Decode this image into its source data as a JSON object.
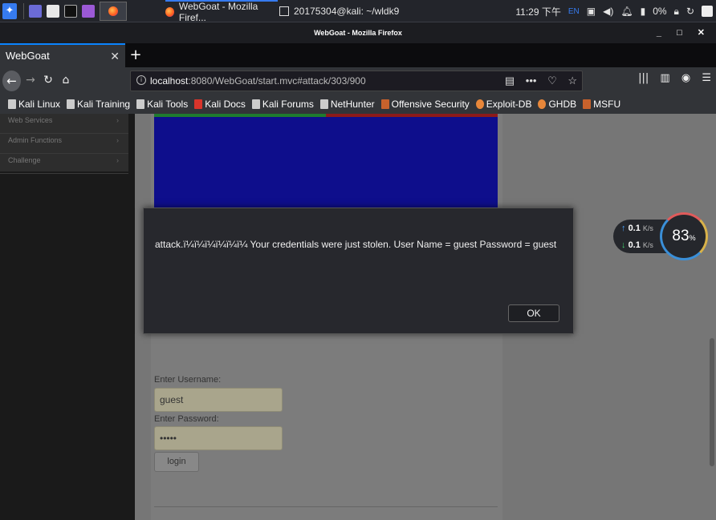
{
  "taskbar": {
    "tasks": [
      {
        "label": "WebGoat - Mozilla Firef..."
      },
      {
        "label": "20175304@kali: ~/wldk9"
      }
    ],
    "time": "11:29 下午",
    "lang": "EN",
    "battery": "0%"
  },
  "window": {
    "title": "WebGoat - Mozilla Firefox",
    "controls": "_ □ ✕"
  },
  "tab": {
    "label": "WebGoat",
    "close": "✕",
    "new": "+"
  },
  "nav": {
    "url_host": "localhost",
    "url_rest": ":8080/WebGoat/start.mvc#attack/303/900"
  },
  "bookmarks": [
    {
      "label": "Kali Linux",
      "color": "#cccccc"
    },
    {
      "label": "Kali Training",
      "color": "#cccccc"
    },
    {
      "label": "Kali Tools",
      "color": "#cccccc"
    },
    {
      "label": "Kali Docs",
      "color": "#d9342b"
    },
    {
      "label": "Kali Forums",
      "color": "#cccccc"
    },
    {
      "label": "NetHunter",
      "color": "#cccccc"
    },
    {
      "label": "Offensive Security",
      "color": "#c8622c"
    },
    {
      "label": "Exploit-DB",
      "color": "#e8873a"
    },
    {
      "label": "GHDB",
      "color": "#e8873a"
    },
    {
      "label": "MSFU",
      "color": "#c8622c"
    }
  ],
  "sidebar": {
    "items": [
      {
        "label": "Web Services",
        "chev": "›"
      },
      {
        "label": "Admin Functions",
        "chev": "›"
      },
      {
        "label": "Challenge",
        "chev": "›"
      }
    ]
  },
  "form": {
    "username_label": "Enter Username:",
    "username_value": "guest",
    "password_label": "Enter Password:",
    "password_value": "•••••",
    "login_label": "login"
  },
  "dialog": {
    "message": "attack.ï¼ï¼ï¼ï¼ï¼ï¼ Your credentials were just stolen. User Name = guest Password = guest",
    "ok_label": "OK"
  },
  "network": {
    "up": "0.1",
    "down": "0.1",
    "unit": "K/s",
    "gauge_value": "83",
    "gauge_unit": "%"
  },
  "colors": {
    "accent": "#0a84ff",
    "blue_box": "#0e0e8c"
  }
}
